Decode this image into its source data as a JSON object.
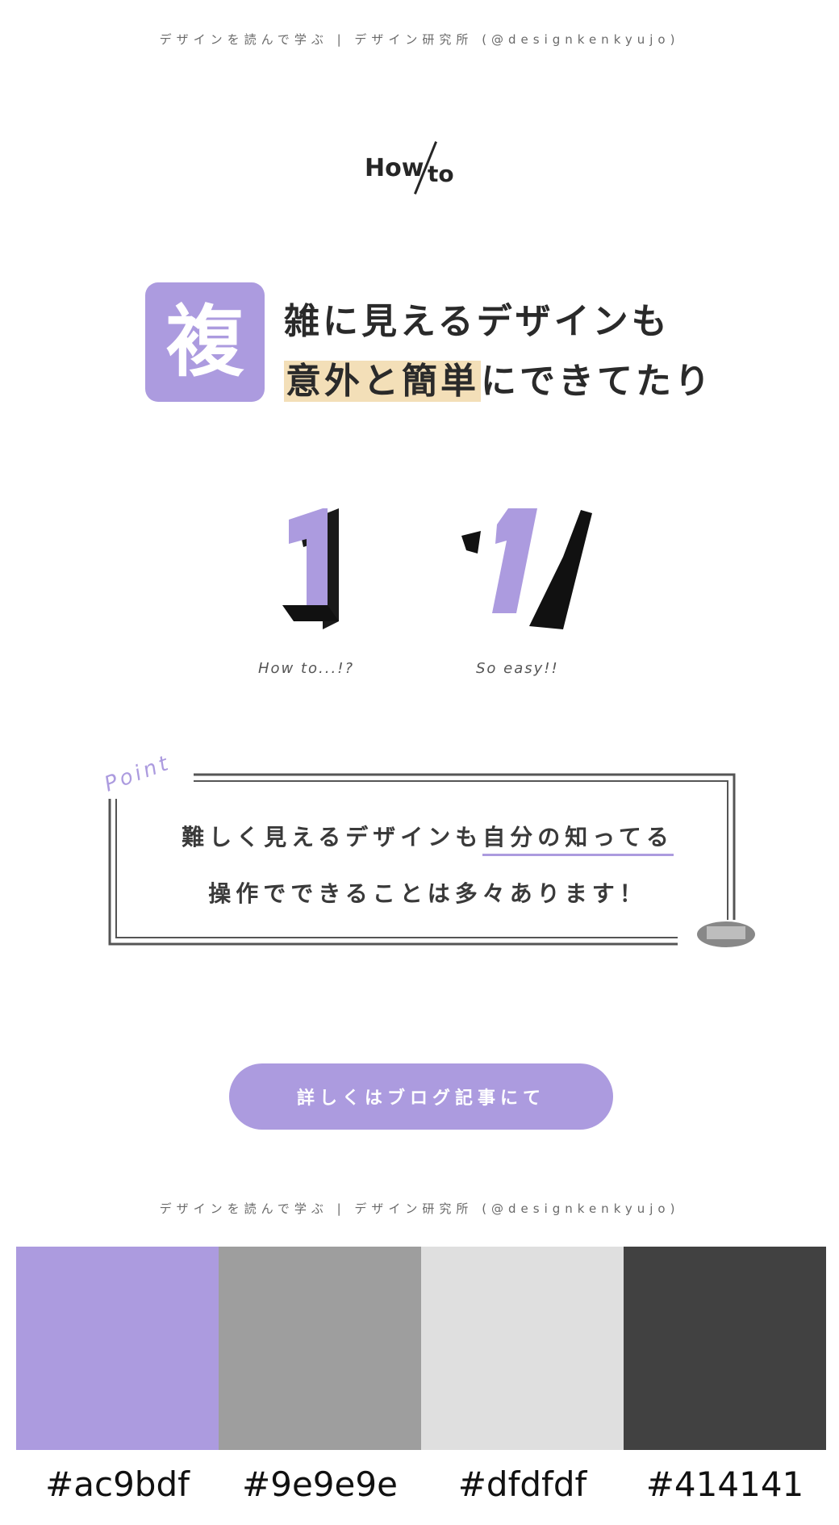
{
  "credit": {
    "top": "デザインを読んで学ぶ | デザイン研究所 (@designkenkyujo)",
    "bottom": "デザインを読んで学ぶ | デザイン研究所 (@designkenkyujo)"
  },
  "howto": {
    "how": "How",
    "to": "to"
  },
  "headline": {
    "kanji": "複",
    "line1": "雑に見えるデザインも",
    "line2_highlight": "意外と簡単",
    "line2_rest": "にできてたり"
  },
  "illustration": {
    "left_number": "1",
    "right_number": "1",
    "left_caption": "How to...!?",
    "right_caption": "So easy!!"
  },
  "point": {
    "label": "Point",
    "line1_pre": "難しく見えるデザインも",
    "line1_underlined": "自分の知ってる",
    "line2": "操作でできることは多々あります！"
  },
  "cta": {
    "label": "詳しくはブログ記事にて"
  },
  "palette": [
    {
      "color": "#ac9bdf",
      "label": "#ac9bdf"
    },
    {
      "color": "#9e9e9e",
      "label": "#9e9e9e"
    },
    {
      "color": "#dfdfdf",
      "label": "#dfdfdf"
    },
    {
      "color": "#414141",
      "label": "#414141"
    }
  ]
}
